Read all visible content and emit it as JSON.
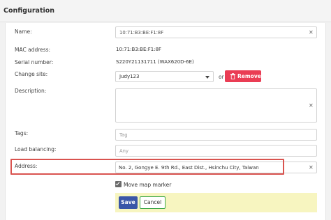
{
  "header": {
    "title": "Configuration"
  },
  "form": {
    "name": {
      "label": "Name:",
      "value": "10:71:B3:BE:F1:8F"
    },
    "mac": {
      "label": "MAC address:",
      "value": "10:71:B3:BE:F1:8F"
    },
    "serial": {
      "label": "Serial number:",
      "value": "S220Y21131711 (WAX620D-6E)"
    },
    "site": {
      "label": "Change site:",
      "selected": "Judy123",
      "or_text": "or",
      "remove_label": "Remove"
    },
    "description": {
      "label": "Description:",
      "value": ""
    },
    "tags": {
      "label": "Tags:",
      "placeholder": "Tag"
    },
    "load_balancing": {
      "label": "Load balancing:",
      "placeholder": "Any"
    },
    "address": {
      "label": "Address:",
      "value": "No. 2, Gongye E. 9th Rd., East Dist., Hsinchu City, Taiwan"
    },
    "move_marker": {
      "label": "Move map marker",
      "checked": true
    }
  },
  "actions": {
    "save_label": "Save",
    "cancel_label": "Cancel"
  },
  "colors": {
    "remove": "#ea3d54",
    "save": "#3a56a8",
    "cancel_border": "#3ca84a",
    "highlight": "#d9534f",
    "footer_bg": "#f7f5c0"
  },
  "icons": {
    "clear": "close-icon",
    "trash": "trash-icon",
    "dropdown": "chevron-down-icon",
    "check": "check-icon"
  }
}
